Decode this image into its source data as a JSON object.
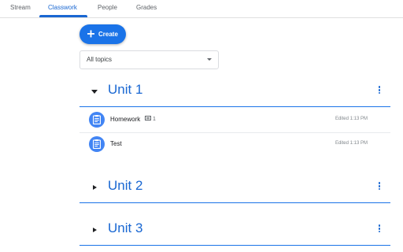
{
  "tabs": [
    {
      "label": "Stream"
    },
    {
      "label": "Classwork"
    },
    {
      "label": "People"
    },
    {
      "label": "Grades"
    }
  ],
  "active_tab": "Classwork",
  "create_label": "Create",
  "topic_filter": {
    "value": "All topics"
  },
  "units": [
    {
      "title": "Unit 1",
      "expanded": true,
      "items": [
        {
          "title": "Homework",
          "comments": "1",
          "edited": "Edited 1:13 PM",
          "icon": "assignment-icon"
        },
        {
          "title": "Test",
          "edited": "Edited 1:13 PM",
          "icon": "assignment-icon"
        }
      ]
    },
    {
      "title": "Unit 2",
      "expanded": false
    },
    {
      "title": "Unit 3",
      "expanded": false
    }
  ],
  "colors": {
    "accent": "#1a73e8",
    "title_blue": "#1967d2",
    "icon_blue": "#4285f4"
  }
}
